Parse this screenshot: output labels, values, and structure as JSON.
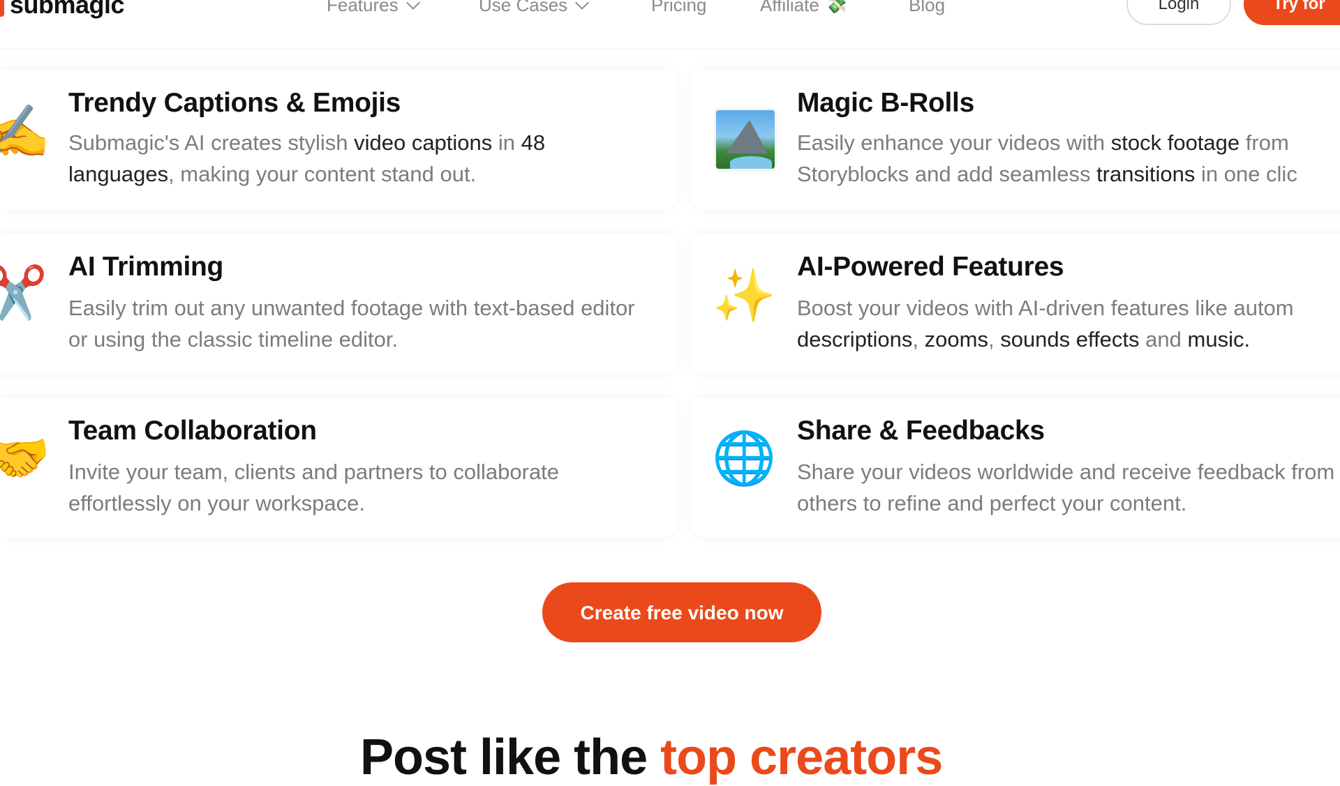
{
  "brand": {
    "name": "submagic",
    "accent_color": "#ea4a1b"
  },
  "nav": {
    "features": "Features",
    "use_cases": "Use Cases",
    "pricing": "Pricing",
    "affiliate": "Affiliate",
    "affiliate_icon": "money-icon",
    "blog": "Blog",
    "login": "Login",
    "try": "Try for"
  },
  "cards": [
    {
      "icon": "writing-hand-icon",
      "title": "Trendy Captions & Emojis",
      "desc": [
        {
          "t": "Submagic's AI creates stylish ",
          "b": false
        },
        {
          "t": "video captions",
          "b": true
        },
        {
          "t": " in ",
          "b": false
        },
        {
          "t": "48 languages",
          "b": true
        },
        {
          "t": ", making your content stand out.",
          "b": false
        }
      ]
    },
    {
      "icon": "landscape-picture-icon",
      "title": "Magic B-Rolls",
      "desc": [
        {
          "t": "Easily enhance your videos with ",
          "b": false
        },
        {
          "t": "stock footage",
          "b": true
        },
        {
          "t": " from Storyblocks and add seamless ",
          "b": false
        },
        {
          "t": "transitions",
          "b": true
        },
        {
          "t": " in one clic",
          "b": false
        }
      ]
    },
    {
      "icon": "scissors-icon",
      "title": "AI Trimming",
      "desc": [
        {
          "t": "Easily trim out any unwanted footage with text-based editor or using the classic timeline editor.",
          "b": false
        }
      ]
    },
    {
      "icon": "sparkles-icon",
      "title": "AI-Powered Features",
      "desc": [
        {
          "t": "Boost your videos with AI-driven features like autom ",
          "b": false
        },
        {
          "t": "descriptions",
          "b": true
        },
        {
          "t": ", ",
          "b": false
        },
        {
          "t": "zooms",
          "b": true
        },
        {
          "t": ", ",
          "b": false
        },
        {
          "t": "sounds effects",
          "b": true
        },
        {
          "t": " and ",
          "b": false
        },
        {
          "t": "music.",
          "b": true
        }
      ]
    },
    {
      "icon": "handshake-icon",
      "title": "Team Collaboration",
      "desc": [
        {
          "t": "Invite your team, clients and partners to collaborate effortlessly on your workspace.",
          "b": false
        }
      ]
    },
    {
      "icon": "globe-icon",
      "title": "Share & Feedbacks",
      "desc": [
        {
          "t": "Share your videos worldwide and receive feedback from others to refine and perfect your content.",
          "b": false
        }
      ]
    }
  ],
  "cta": {
    "label": "Create free video now"
  },
  "bottom_heading": {
    "part1": "Post like the ",
    "accent": "top creators"
  }
}
